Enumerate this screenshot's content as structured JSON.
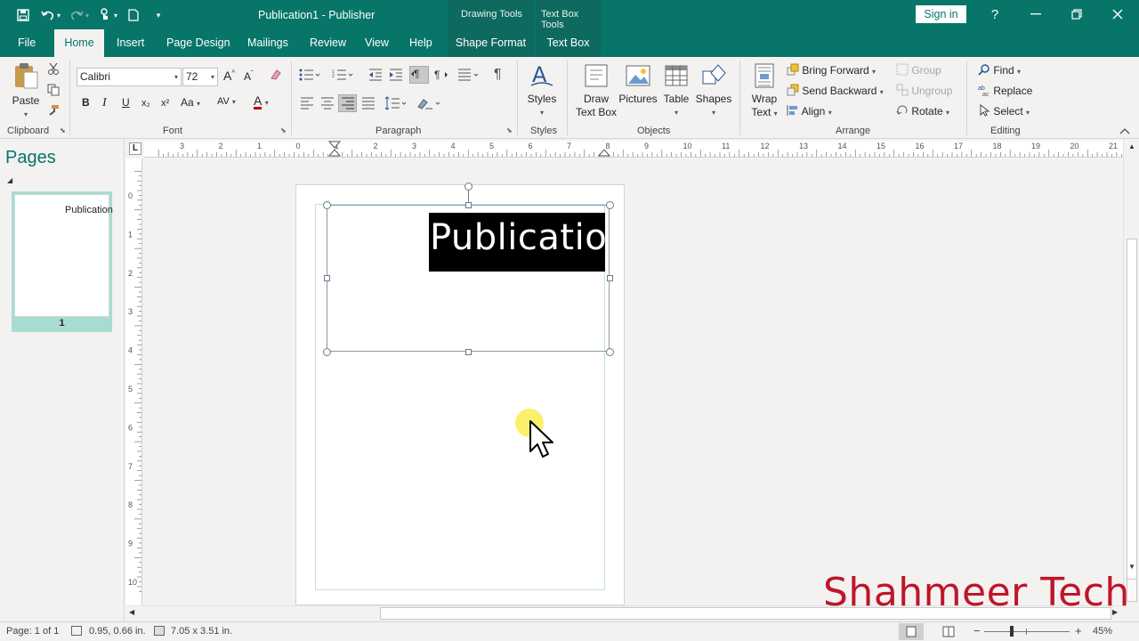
{
  "app": {
    "document_title": "Publication1  -  Publisher",
    "context_groups": [
      "Drawing Tools",
      "Text Box Tools"
    ],
    "sign_in": "Sign in",
    "help_symbol": "?",
    "accent_color": "#077568"
  },
  "tabs": [
    {
      "label": "File"
    },
    {
      "label": "Home"
    },
    {
      "label": "Insert"
    },
    {
      "label": "Page Design"
    },
    {
      "label": "Mailings"
    },
    {
      "label": "Review"
    },
    {
      "label": "View"
    },
    {
      "label": "Help"
    },
    {
      "label": "Shape Format"
    },
    {
      "label": "Text Box"
    }
  ],
  "active_tab": "Home",
  "ribbon": {
    "clipboard": {
      "paste": "Paste",
      "label": "Clipboard"
    },
    "font": {
      "name": "Calibri",
      "size": "72",
      "label": "Font",
      "bold": "B",
      "italic": "I",
      "underline": "U",
      "subscript": "x₂",
      "superscript": "x²",
      "change_case": "Aa",
      "spacing": "AV",
      "color_letter": "A",
      "grow": "A",
      "shrink": "A"
    },
    "paragraph": {
      "label": "Paragraph",
      "pilcrow": "¶"
    },
    "styles": {
      "button": "Styles",
      "label": "Styles"
    },
    "objects": {
      "label": "Objects",
      "draw_text_box_1": "Draw",
      "draw_text_box_2": "Text Box",
      "pictures": "Pictures",
      "table": "Table",
      "shapes": "Shapes"
    },
    "arrange": {
      "label": "Arrange",
      "wrap_1": "Wrap",
      "wrap_2": "Text",
      "bring_forward": "Bring Forward",
      "send_backward": "Send Backward",
      "align": "Align",
      "group": "Group",
      "ungroup": "Ungroup",
      "rotate": "Rotate"
    },
    "editing": {
      "label": "Editing",
      "find": "Find",
      "replace": "Replace",
      "select": "Select"
    }
  },
  "ruler": {
    "h_labels": [
      "3",
      "2",
      "1",
      "0",
      "1",
      "2",
      "3",
      "4",
      "5",
      "6",
      "7",
      "8",
      "9",
      "10",
      "11",
      "12",
      "13",
      "14",
      "15",
      "16",
      "17",
      "18",
      "19",
      "20",
      "21"
    ],
    "v_labels": [
      "0",
      "1",
      "2",
      "3",
      "4",
      "5",
      "6",
      "7",
      "8",
      "9",
      "10"
    ],
    "corner": "L"
  },
  "pages_pane": {
    "title": "Pages",
    "thumb_text": "Publication",
    "page_number": "1"
  },
  "document": {
    "text": "Publication"
  },
  "status": {
    "page": "Page: 1 of 1",
    "position": "0.95, 0.66 in.",
    "size": "7.05 x 3.51 in.",
    "zoom": "45%",
    "zoom_level": 0.45
  },
  "watermark": "Shahmeer Tech"
}
